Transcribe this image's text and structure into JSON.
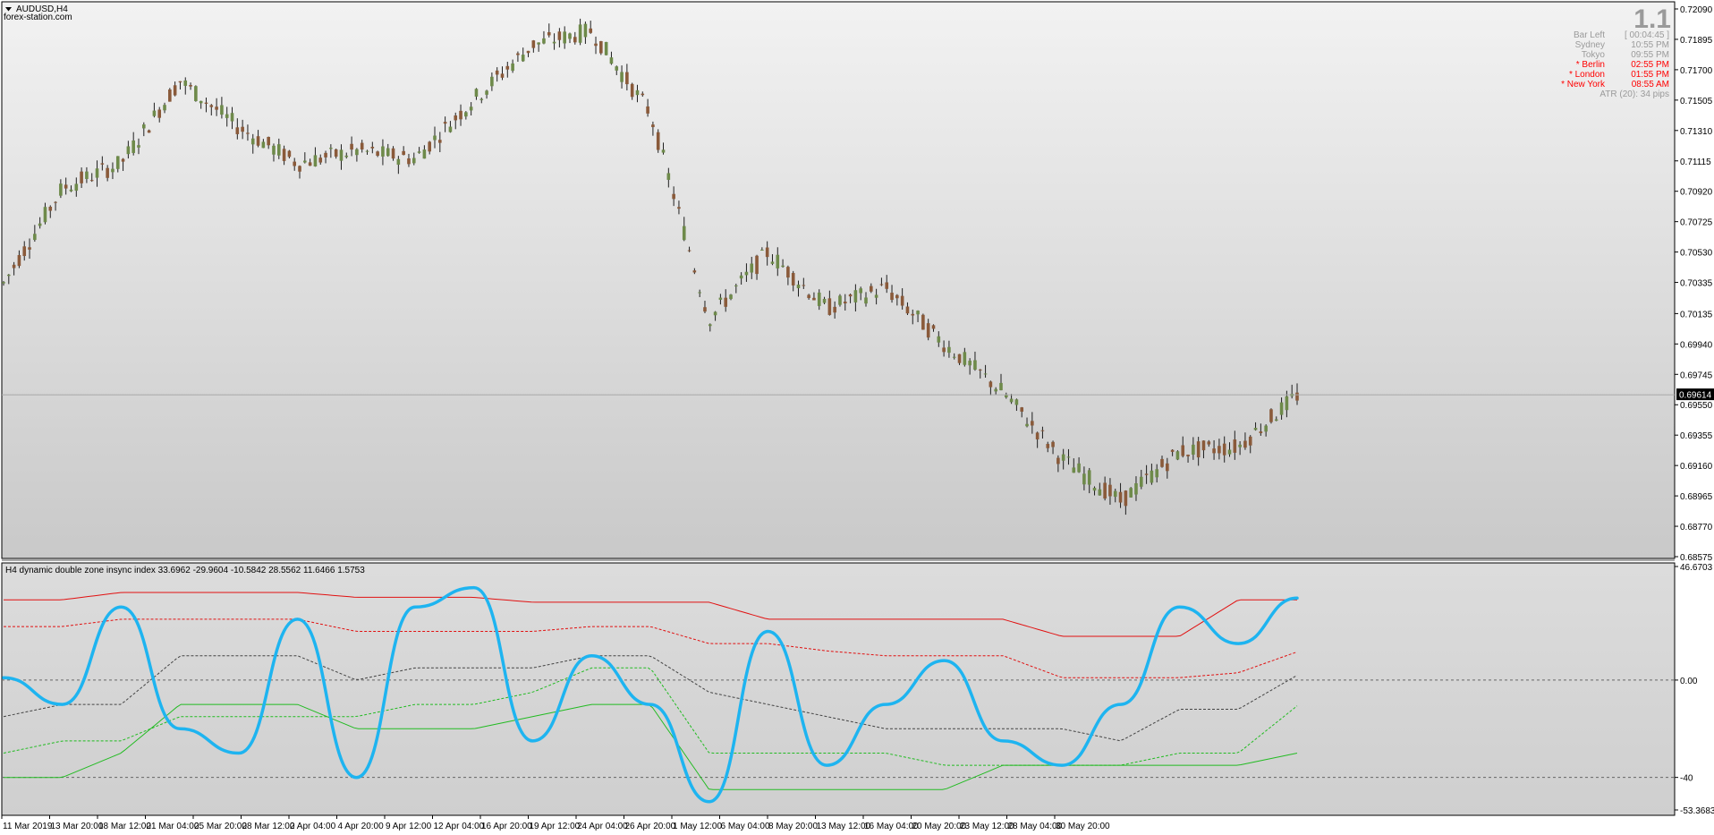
{
  "symbol_title": "AUDUSD,H4",
  "watermark": "forex-station.com",
  "big_number": "1.1",
  "info_panel": {
    "rows": [
      {
        "label": "Bar Left",
        "value": "[ 00:04:45 ]",
        "color": "#9a9a9a"
      },
      {
        "label": "Sydney",
        "value": "10:55 PM",
        "color": "#9a9a9a"
      },
      {
        "label": "Tokyo",
        "value": "09:55 PM",
        "color": "#9a9a9a"
      },
      {
        "label": "* Berlin",
        "value": "02:55 PM",
        "color": "#ff0000"
      },
      {
        "label": "* London",
        "value": "01:55 PM",
        "color": "#ff0000"
      },
      {
        "label": "* New York",
        "value": "08:55 AM",
        "color": "#ff0000"
      }
    ],
    "atr": "ATR (20): 34 pips"
  },
  "indicator_title": "H4 dynamic double zone insync index 33.6962 -29.9604 -10.5842 28.5562 11.6466 1.5753",
  "price_axis": {
    "ticks": [
      "0.72090",
      "0.71895",
      "0.71700",
      "0.71505",
      "0.71310",
      "0.71115",
      "0.70920",
      "0.70725",
      "0.70530",
      "0.70335",
      "0.70135",
      "0.69940",
      "0.69745",
      "0.69550",
      "0.69355",
      "0.69160",
      "0.68965",
      "0.68770",
      "0.68575"
    ],
    "current_price": "0.69614",
    "range": [
      0.68575,
      0.7209
    ]
  },
  "indicator_axis": {
    "ticks": [
      "46.6703",
      "0.00",
      "-40",
      "-53.3683"
    ],
    "range": [
      -53.3683,
      46.6703
    ],
    "zero_line": 0,
    "lower_line": -40
  },
  "time_axis": {
    "labels": [
      "11 Mar 2019",
      "13 Mar 20:00",
      "18 Mar 12:00",
      "21 Mar 04:00",
      "25 Mar 20:00",
      "28 Mar 12:00",
      "2 Apr 04:00",
      "4 Apr 20:00",
      "9 Apr 12:00",
      "12 Apr 04:00",
      "16 Apr 20:00",
      "19 Apr 12:00",
      "24 Apr 04:00",
      "26 Apr 20:00",
      "1 May 12:00",
      "6 May 04:00",
      "8 May 20:00",
      "13 May 12:00",
      "16 May 04:00",
      "20 May 20:00",
      "23 May 12:00",
      "28 May 04:00",
      "30 May 20:00"
    ]
  },
  "colors": {
    "chart_bg_top": "#f2f2f2",
    "chart_bg_bottom": "#c8c8c8",
    "candle_up": "#6e8a4a",
    "candle_down": "#8a5a3a",
    "wick": "#1e1e1e",
    "indicator_line": "#1eb4f0",
    "red_band": "#e11010",
    "green_band": "#22bb22",
    "mid_band": "#444444",
    "price_line": "#a8a8a8"
  },
  "chart_data": [
    {
      "type": "line",
      "title": "AUDUSD,H4",
      "x": [
        "11 Mar 2019",
        "13 Mar 20:00",
        "18 Mar 12:00",
        "21 Mar 04:00",
        "25 Mar 20:00",
        "28 Mar 12:00",
        "2 Apr 04:00",
        "4 Apr 20:00",
        "9 Apr 12:00",
        "12 Apr 04:00",
        "16 Apr 20:00",
        "19 Apr 12:00",
        "24 Apr 04:00",
        "26 Apr 20:00",
        "1 May 12:00",
        "6 May 04:00",
        "8 May 20:00",
        "13 May 12:00",
        "16 May 04:00",
        "20 May 20:00",
        "23 May 12:00",
        "28 May 04:00",
        "30 May 20:00"
      ],
      "series": [
        {
          "values": [
            0.7033,
            0.7094,
            0.711,
            0.7163,
            0.7133,
            0.711,
            0.7118,
            0.7113,
            0.7151,
            0.7186,
            0.7195,
            0.7142,
            0.701,
            0.7053,
            0.7017,
            0.703,
            0.6994,
            0.6963,
            0.692,
            0.6893,
            0.6925,
            0.6928,
            0.6961
          ]
        }
      ],
      "ylim": [
        0.68575,
        0.7209
      ],
      "current_price": 0.69614
    },
    {
      "type": "line",
      "title": "H4 dynamic double zone insync index 33.6962 -29.9604 -10.5842 28.5562 11.6466 1.5753",
      "x": [
        "11 Mar 2019",
        "13 Mar 20:00",
        "18 Mar 12:00",
        "21 Mar 04:00",
        "25 Mar 20:00",
        "28 Mar 12:00",
        "2 Apr 04:00",
        "4 Apr 20:00",
        "9 Apr 12:00",
        "12 Apr 04:00",
        "16 Apr 20:00",
        "19 Apr 12:00",
        "24 Apr 04:00",
        "26 Apr 20:00",
        "1 May 12:00",
        "6 May 04:00",
        "8 May 20:00",
        "13 May 12:00",
        "16 May 04:00",
        "20 May 20:00",
        "23 May 12:00",
        "28 May 04:00",
        "30 May 20:00"
      ],
      "series": [
        {
          "values": [
            1,
            -10,
            30,
            -20,
            -30,
            25,
            -40,
            30,
            38,
            -25,
            10,
            -10,
            -50,
            20,
            -35,
            -10,
            8,
            -25,
            -35,
            -10,
            30,
            15,
            33.7
          ],
          "color": "#1eb4f0"
        },
        {
          "values": [
            33,
            33,
            36,
            36,
            36,
            36,
            34,
            34,
            34,
            32,
            32,
            32,
            32,
            25,
            25,
            25,
            25,
            25,
            18,
            18,
            18,
            33,
            33
          ],
          "color": "#e11010"
        },
        {
          "values": [
            22,
            22,
            25,
            25,
            25,
            25,
            20,
            20,
            20,
            20,
            22,
            22,
            15,
            15,
            12,
            10,
            10,
            10,
            1,
            1,
            1,
            3,
            11.6
          ],
          "color": "#e11010"
        },
        {
          "values": [
            -15,
            -10,
            -10,
            10,
            10,
            10,
            0,
            5,
            5,
            5,
            10,
            10,
            -5,
            -10,
            -15,
            -20,
            -20,
            -20,
            -20,
            -25,
            -12,
            -12,
            2
          ],
          "color": "#444444"
        },
        {
          "values": [
            -30,
            -25,
            -25,
            -15,
            -15,
            -15,
            -15,
            -10,
            -10,
            -5,
            5,
            5,
            -30,
            -30,
            -30,
            -30,
            -35,
            -35,
            -35,
            -35,
            -30,
            -30,
            -10.6
          ],
          "color": "#22bb22"
        },
        {
          "values": [
            -40,
            -40,
            -30,
            -10,
            -10,
            -10,
            -20,
            -20,
            -20,
            -15,
            -10,
            -10,
            -45,
            -45,
            -45,
            -45,
            -45,
            -35,
            -35,
            -35,
            -35,
            -35,
            -30
          ],
          "color": "#22bb22"
        }
      ],
      "ylim": [
        -53.3683,
        46.6703
      ]
    }
  ]
}
